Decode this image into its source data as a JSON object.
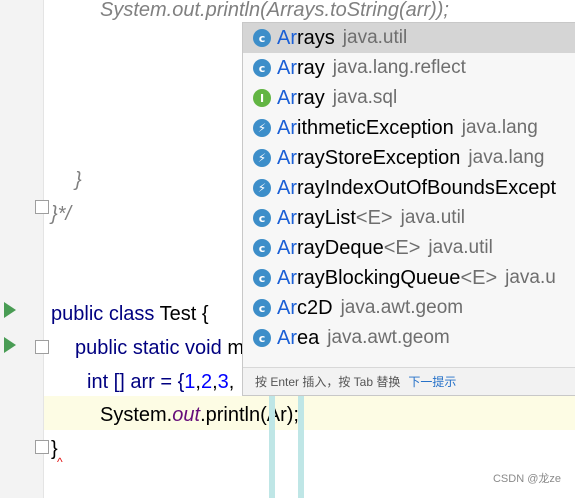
{
  "editor": {
    "comment_call": "System.out.println(Arrays.toString(arr));",
    "comment_close_brace": "}",
    "comment_end": "}*/",
    "class_kw": "public class",
    "class_name": "Test {",
    "method_prefix": "public static void",
    "method_tail": "m",
    "array_type": "int [] arr = {",
    "array_n1": "1",
    "comma1": ",",
    "array_n2": "2",
    "comma2": ",",
    "array_n3": "3",
    "comma3": ",",
    "print_prefix": "System.",
    "print_field": "out",
    "print_suffix": ".println(Ar);",
    "close_brace": "}",
    "error_mark": "^"
  },
  "completion": {
    "items": [
      {
        "match": "Ar",
        "rest": "rays",
        "generic": "",
        "package": "java.util",
        "icon": "class-icon",
        "icon_glyph": "c"
      },
      {
        "match": "Ar",
        "rest": "ray",
        "generic": "",
        "package": "java.lang.reflect",
        "icon": "class-icon",
        "icon_glyph": "c"
      },
      {
        "match": "Ar",
        "rest": "ray",
        "generic": "",
        "package": "java.sql",
        "icon": "interface-icon",
        "icon_glyph": "I"
      },
      {
        "match": "Ar",
        "rest": "ithmeticException",
        "generic": "",
        "package": "java.lang",
        "icon": "exception-icon",
        "icon_glyph": "⚡"
      },
      {
        "match": "Ar",
        "rest": "rayStoreException",
        "generic": "",
        "package": "java.lang",
        "icon": "exception-icon",
        "icon_glyph": "⚡"
      },
      {
        "match": "Ar",
        "rest": "rayIndexOutOfBoundsExcept",
        "generic": "",
        "package": "",
        "icon": "exception-icon",
        "icon_glyph": "⚡"
      },
      {
        "match": "Ar",
        "rest": "rayList",
        "generic": "<E>",
        "package": "java.util",
        "icon": "class-icon",
        "icon_glyph": "c"
      },
      {
        "match": "Ar",
        "rest": "rayDeque",
        "generic": "<E>",
        "package": "java.util",
        "icon": "class-icon",
        "icon_glyph": "c"
      },
      {
        "match": "Ar",
        "rest": "rayBlockingQueue",
        "generic": "<E>",
        "package": "java.u",
        "icon": "class-icon",
        "icon_glyph": "c"
      },
      {
        "match": "Ar",
        "rest": "c2D",
        "generic": "",
        "package": "java.awt.geom",
        "icon": "class-icon",
        "icon_glyph": "c"
      },
      {
        "match": "Ar",
        "rest": "ea",
        "generic": "",
        "package": "java.awt.geom",
        "icon": "class-icon",
        "icon_glyph": "c"
      }
    ],
    "footer_hint": "按 Enter 插入，按 Tab 替换",
    "footer_tip": "下一提示"
  },
  "watermark": "CSDN @龙ze",
  "colors": {
    "selected_row": "#d5d5d5",
    "match_text": "#1a5fd6",
    "keyword": "#000080",
    "number": "#0000ff",
    "field": "#660e7a",
    "comment": "#808080"
  }
}
